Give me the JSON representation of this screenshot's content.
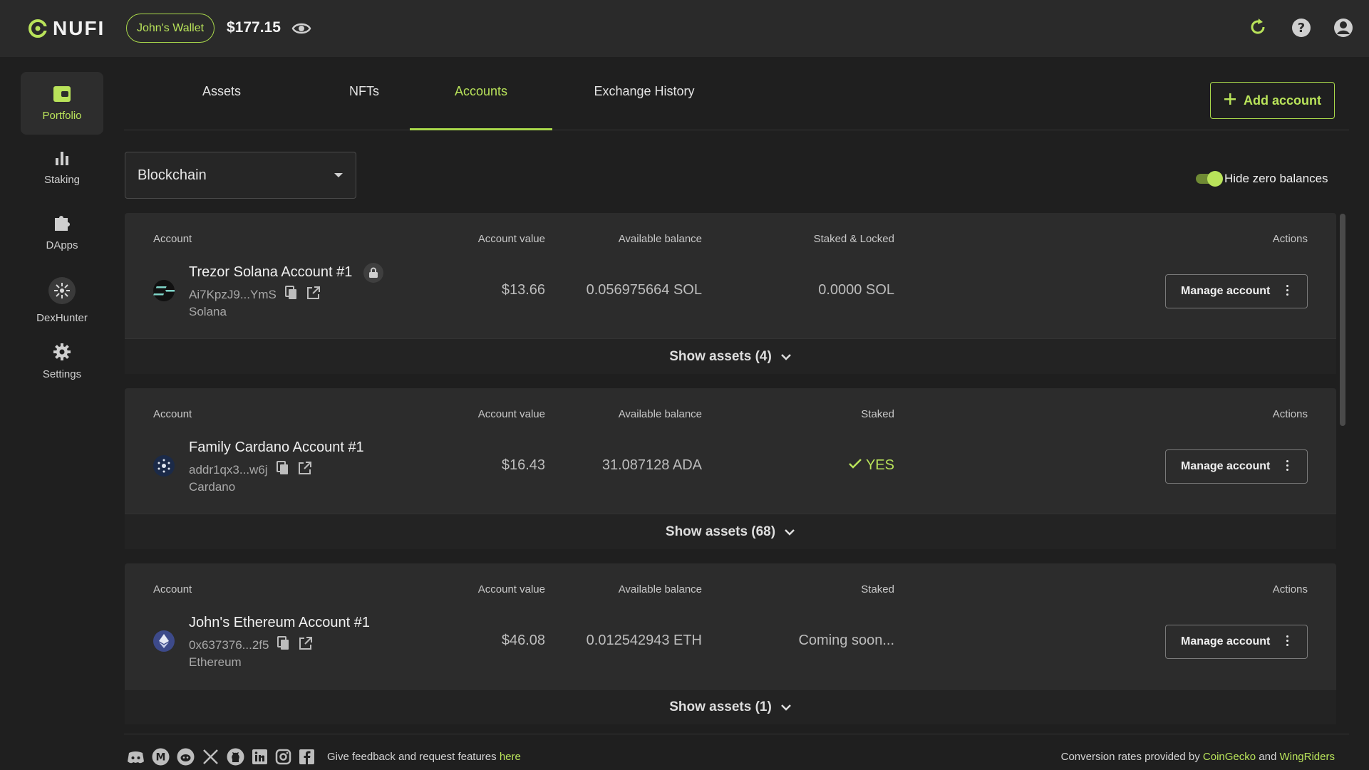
{
  "header": {
    "logo_text": "NUFI",
    "wallet_name": "John's Wallet",
    "balance": "$177.15"
  },
  "sidebar": {
    "items": [
      {
        "label": "Portfolio",
        "icon": "wallet-icon",
        "active": true
      },
      {
        "label": "Staking",
        "icon": "bar-chart-icon"
      },
      {
        "label": "DApps",
        "icon": "puzzle-icon"
      },
      {
        "label": "DexHunter",
        "icon": "dexhunter-icon"
      },
      {
        "label": "Settings",
        "icon": "gear-icon"
      }
    ]
  },
  "tabs": [
    {
      "label": "Assets"
    },
    {
      "label": "NFTs"
    },
    {
      "label": "Accounts",
      "active": true
    },
    {
      "label": "Exchange History"
    }
  ],
  "add_account_label": "Add account",
  "filter": {
    "selected": "Blockchain"
  },
  "hide_zero": {
    "label": "Hide zero balances",
    "on": true
  },
  "accounts": [
    {
      "headers": [
        "Account",
        "Account value",
        "Available balance",
        "Staked & Locked",
        "Actions"
      ],
      "name": "Trezor Solana Account #1",
      "address": "Ai7KpzJ9...YmS",
      "chain": "Solana",
      "value": "$13.66",
      "available": "0.056975664 SOL",
      "staked": "0.0000 SOL",
      "manage_label": "Manage account",
      "show_assets": "Show assets (4)"
    },
    {
      "headers": [
        "Account",
        "Account value",
        "Available balance",
        "Staked",
        "Actions"
      ],
      "name": "Family Cardano Account #1",
      "address": "addr1qx3...w6j",
      "chain": "Cardano",
      "value": "$16.43",
      "available": "31.087128 ADA",
      "staked": "YES",
      "manage_label": "Manage account",
      "show_assets": "Show assets (68)"
    },
    {
      "headers": [
        "Account",
        "Account value",
        "Available balance",
        "Staked",
        "Actions"
      ],
      "name": "John's Ethereum Account #1",
      "address": "0x637376...2f5",
      "chain": "Ethereum",
      "value": "$46.08",
      "available": "0.012542943 ETH",
      "staked": "Coming soon...",
      "manage_label": "Manage account",
      "show_assets": "Show assets (1)"
    }
  ],
  "footer": {
    "feedback_text": "Give feedback and request features",
    "feedback_link": "here",
    "conv_prefix": "Conversion rates provided by",
    "coingecko": "CoinGecko",
    "and": "and",
    "wingriders": "WingRiders"
  },
  "colors": {
    "accent": "#b9e35a",
    "background": "#1f1f1f",
    "card": "#2c2c2c"
  }
}
